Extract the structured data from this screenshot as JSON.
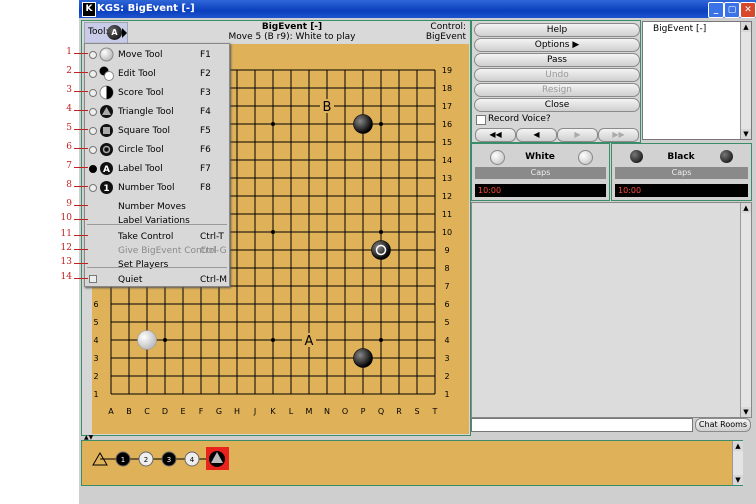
{
  "window": {
    "title": "KGS: BigEvent [-]",
    "app_icon": "K",
    "controls": [
      "_",
      "▢",
      "✕"
    ]
  },
  "board_header": {
    "tool_label": "Tool:",
    "tool_icon_letter": "A",
    "game_name": "BigEvent [-]",
    "move_status": "Move 5 (B r9): White to play",
    "control_label": "Control:",
    "control_value": "BigEvent"
  },
  "tool_menu": {
    "items": [
      {
        "label": "Move Tool",
        "key": "F1",
        "icon": "white-stone-icon",
        "type": "radio"
      },
      {
        "label": "Edit Tool",
        "key": "F2",
        "icon": "edit-stones-icon",
        "type": "radio"
      },
      {
        "label": "Score Tool",
        "key": "F3",
        "icon": "half-stone-icon",
        "type": "radio"
      },
      {
        "label": "Triangle Tool",
        "key": "F4",
        "icon": "triangle-marker-icon",
        "type": "radio"
      },
      {
        "label": "Square Tool",
        "key": "F5",
        "icon": "square-marker-icon",
        "type": "radio"
      },
      {
        "label": "Circle Tool",
        "key": "F6",
        "icon": "circle-marker-icon",
        "type": "radio"
      },
      {
        "label": "Label Tool",
        "key": "F7",
        "icon": "label-marker-icon",
        "type": "radio",
        "selected": true
      },
      {
        "label": "Number Tool",
        "key": "F8",
        "icon": "number-marker-icon",
        "type": "radio"
      },
      {
        "label": "Number Moves",
        "key": "",
        "type": "plain"
      },
      {
        "label": "Label Variations",
        "key": "",
        "type": "plain"
      },
      {
        "label": "Take Control",
        "key": "Ctrl-T",
        "type": "plain"
      },
      {
        "label": "Give BigEvent Control",
        "key": "Ctrl-G",
        "type": "plain",
        "disabled": true
      },
      {
        "label": "Set Players",
        "key": "",
        "type": "plain"
      },
      {
        "label": "Quiet",
        "key": "Ctrl-M",
        "type": "check"
      }
    ],
    "callouts": [
      "1",
      "2",
      "3",
      "4",
      "5",
      "6",
      "7",
      "8",
      "9",
      "10",
      "11",
      "12",
      "13",
      "14"
    ]
  },
  "board": {
    "columns": [
      "A",
      "B",
      "C",
      "D",
      "E",
      "F",
      "G",
      "H",
      "J",
      "K",
      "L",
      "M",
      "N",
      "O",
      "P",
      "Q",
      "R",
      "S",
      "T"
    ],
    "rows": [
      "19",
      "18",
      "17",
      "16",
      "15",
      "14",
      "13",
      "12",
      "11",
      "10",
      "9",
      "8",
      "7",
      "6",
      "5",
      "4",
      "3",
      "2",
      "1"
    ],
    "stones": [
      {
        "color": "black",
        "col": 15,
        "row": 16
      },
      {
        "color": "black",
        "col": 16,
        "row": 9,
        "last_move": true
      },
      {
        "color": "white",
        "col": 3,
        "row": 4
      },
      {
        "color": "black",
        "col": 15,
        "row": 3
      }
    ],
    "labels": [
      {
        "text": "B",
        "col": 13,
        "row": 17
      },
      {
        "text": "A",
        "col": 12,
        "row": 4
      }
    ],
    "star_points": [
      [
        4,
        4
      ],
      [
        10,
        4
      ],
      [
        16,
        4
      ],
      [
        4,
        10
      ],
      [
        10,
        10
      ],
      [
        16,
        10
      ],
      [
        4,
        16
      ],
      [
        10,
        16
      ],
      [
        16,
        16
      ]
    ]
  },
  "controls": {
    "buttons": [
      {
        "label": "Help",
        "disabled": false
      },
      {
        "label": "Options",
        "disabled": false
      },
      {
        "label": "Pass",
        "disabled": false
      },
      {
        "label": "Undo",
        "disabled": true
      },
      {
        "label": "Resign",
        "disabled": true
      },
      {
        "label": "Close",
        "disabled": false
      }
    ],
    "record_voice": "Record Voice?",
    "nav": [
      "◀◀",
      "◀",
      "▶",
      "▶▶"
    ]
  },
  "game_list": {
    "items": [
      "BigEvent [-]"
    ]
  },
  "players": {
    "white": {
      "name": "White",
      "caps": "Caps",
      "clock": "10:00"
    },
    "black": {
      "name": "Black",
      "caps": "Caps",
      "clock": "10:00"
    }
  },
  "chat": {
    "rooms_button": "Chat Rooms",
    "input_placeholder": ""
  },
  "tree": {
    "nodes": [
      "",
      "1",
      "2",
      "3",
      "4",
      ""
    ]
  }
}
